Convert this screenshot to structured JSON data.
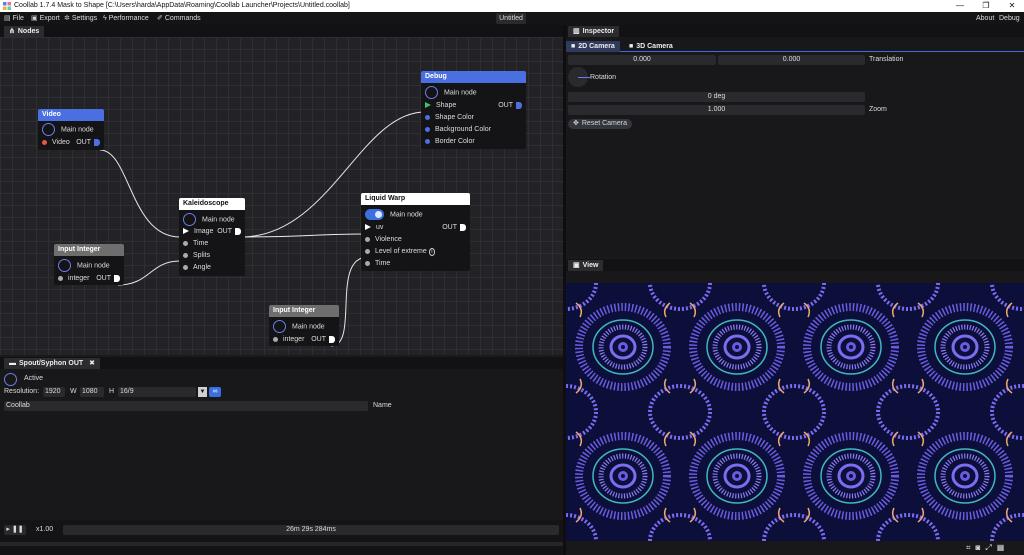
{
  "titlebar": {
    "title": "Coollab 1.7.4 Mask to Shape [C:\\Users\\harda\\AppData\\Roaming\\Coollab Launcher\\Projects\\Untitled.coollab]",
    "minimize": "—",
    "maximize": "❐",
    "close": "✕"
  },
  "menubar": {
    "items": [
      "File",
      "Export",
      "Settings",
      "Performance",
      "Commands"
    ],
    "document_title": "Untitled",
    "right_items": [
      "About",
      "Debug"
    ]
  },
  "nodes_panel": {
    "tab_label": "Nodes",
    "nodes": {
      "video": {
        "title": "Video",
        "main": "Main node",
        "out_pin": "Video",
        "out": "OUT",
        "header_color": "#4a6fe0"
      },
      "input_integer_1": {
        "title": "Input Integer",
        "main": "Main node",
        "out_pin": "integer",
        "out": "OUT",
        "header_color": "#6e6e6e"
      },
      "kaleidoscope": {
        "title": "Kaleidoscope",
        "main": "Main node",
        "inputs": [
          "Image",
          "Time",
          "Splits",
          "Angle"
        ],
        "out": "OUT",
        "header_color": "#ffffff"
      },
      "debug": {
        "title": "Debug",
        "main": "Main node",
        "inputs": [
          "Shape",
          "Shape Color",
          "Background Color",
          "Border Color"
        ],
        "out": "OUT",
        "header_color": "#4a6fe0"
      },
      "liquid_warp": {
        "title": "Liquid Warp",
        "main": "Main node",
        "inputs": [
          "uv",
          "Violence",
          "Level of extreme",
          "Time"
        ],
        "out": "OUT",
        "header_color": "#ffffff"
      },
      "input_integer_2": {
        "title": "Input Integer",
        "main": "Main node",
        "out_pin": "integer",
        "out": "OUT",
        "header_color": "#6e6e6e"
      }
    }
  },
  "spout_panel": {
    "tab_label": "Spout/Syphon OUT",
    "close": "✖",
    "active_label": "Active",
    "resolution_label": "Resolution:",
    "width_value": "1920",
    "width_label": "W",
    "height_value": "1080",
    "height_label": "H",
    "aspect_value": "16/9",
    "name_value": "Coollab",
    "name_label": "Name"
  },
  "timeline": {
    "speed": "x1.00",
    "time": "26m 29s 284ms"
  },
  "inspector": {
    "tab_label": "Inspector",
    "subtabs": [
      "2D Camera",
      "3D Camera"
    ],
    "translation_x": "0.000",
    "translation_y": "0.000",
    "translation_label": "Translation",
    "rotation_label": "Rotation",
    "rotation_value": "0 deg",
    "zoom_value": "1.000",
    "zoom_label": "Zoom",
    "reset_label": "Reset Camera"
  },
  "view_panel": {
    "tab_label": "View"
  },
  "colors": {
    "accent": "#4a6fe0",
    "panel_bg": "#18181a",
    "render_bg": "#0c0f3a",
    "render_pattern_1": "#7d6bf0",
    "render_pattern_2": "#f0a870"
  }
}
